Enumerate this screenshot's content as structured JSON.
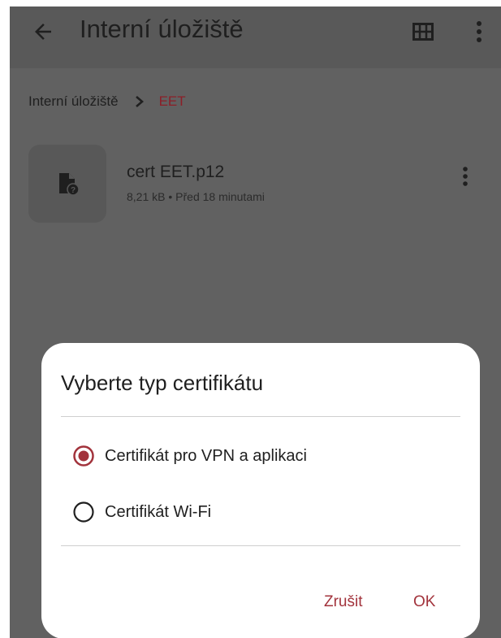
{
  "app_bar": {
    "title": "Interní úložiště",
    "icons": [
      "back-arrow-icon",
      "grid-view-icon",
      "more-vert-icon"
    ]
  },
  "breadcrumb": {
    "parent": "Interní úložiště",
    "current": "EET"
  },
  "file": {
    "name": "cert EET.p12",
    "meta": "8,21 kB • Před 18 minutami",
    "icon": "unknown-file-icon"
  },
  "dialog": {
    "title": "Vyberte typ certifikátu",
    "options": [
      {
        "label": "Certifikát pro VPN a aplikaci",
        "selected": true
      },
      {
        "label": "Certifikát Wi-Fi",
        "selected": false
      }
    ],
    "cancel_label": "Zrušit",
    "ok_label": "OK"
  },
  "colors": {
    "accent": "#a2333c",
    "breadcrumb_current": "#8c1f28",
    "scrim_background": "#616161"
  }
}
